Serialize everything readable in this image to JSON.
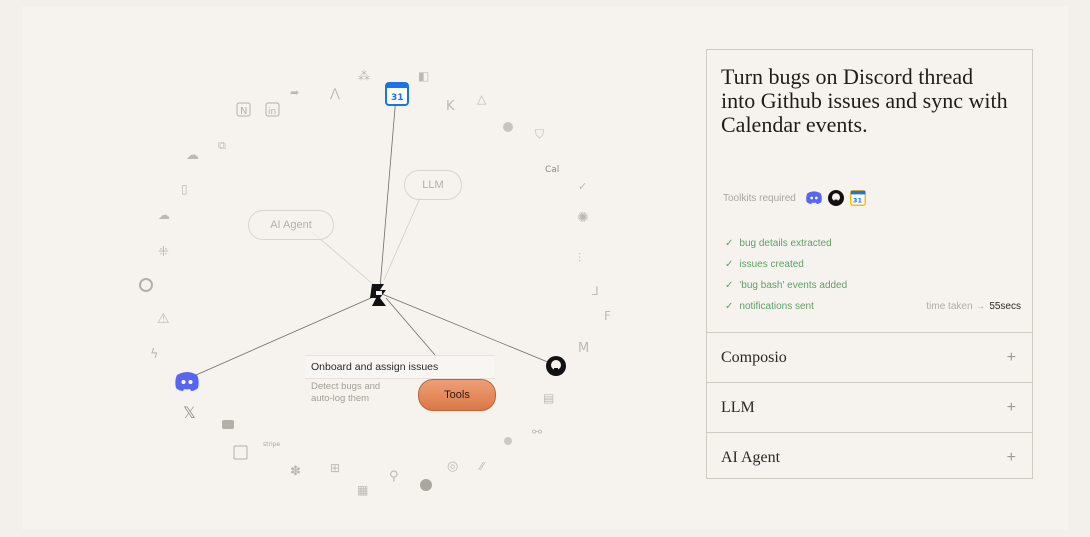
{
  "diagram": {
    "nodes": {
      "llm": "LLM",
      "ai_agent": "AI Agent"
    },
    "task": {
      "title": "Onboard and assign issues",
      "description": "Detect bugs and auto-log them",
      "button": "Tools"
    },
    "ring_labels": {
      "cal": "Cal",
      "stripe": "stripe"
    }
  },
  "panel": {
    "headline": "Turn bugs on Discord thread into Github issues and sync with Calendar events.",
    "toolkits_label": "Toolkits required",
    "toolkit_icons": [
      "discord-icon",
      "github-icon",
      "google-calendar-icon"
    ],
    "steps": [
      "bug details extracted",
      "issues created",
      "'bug bash' events added",
      "notifications sent"
    ],
    "time_taken_label": "time taken →",
    "time_taken_value": "55secs",
    "accordion": [
      {
        "label": "Composio",
        "icon": "+"
      },
      {
        "label": "LLM",
        "icon": "+"
      },
      {
        "label": "AI Agent",
        "icon": "+"
      }
    ]
  },
  "colors": {
    "background": "#f3f0eb",
    "accent_orange": "#e08a5c",
    "success_green": "#5e9f66",
    "discord_blue": "#5865f2",
    "border": "#cfcac2"
  }
}
